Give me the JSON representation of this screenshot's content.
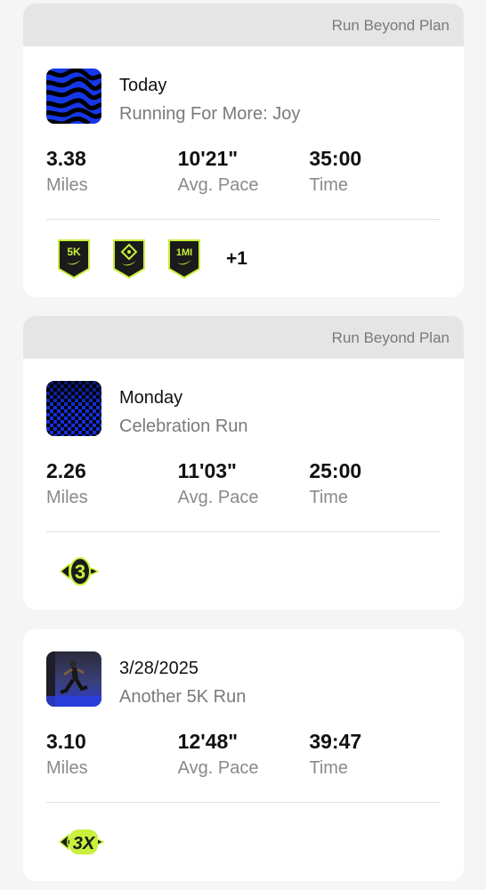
{
  "activities": [
    {
      "header": "Run Beyond Plan",
      "when": "Today",
      "name": "Running For More: Joy",
      "thumbnail": "blue-wavy-pattern",
      "stats": [
        {
          "value": "3.38",
          "label": "Miles"
        },
        {
          "value": "10'21\"",
          "label": "Avg. Pace"
        },
        {
          "value": "35:00",
          "label": "Time"
        }
      ],
      "badges": [
        {
          "icon": "5k-badge-icon",
          "text": "5K"
        },
        {
          "icon": "diamond-badge-icon",
          "text": ""
        },
        {
          "icon": "1mi-badge-icon",
          "text": "1MI"
        }
      ],
      "more_badges": "+1"
    },
    {
      "header": "Run Beyond Plan",
      "when": "Monday",
      "name": "Celebration Run",
      "thumbnail": "blue-checker-pattern",
      "stats": [
        {
          "value": "2.26",
          "label": "Miles"
        },
        {
          "value": "11'03\"",
          "label": "Avg. Pace"
        },
        {
          "value": "25:00",
          "label": "Time"
        }
      ],
      "badges": [
        {
          "icon": "3-streak-arrow-badge-icon",
          "text": "3"
        }
      ]
    },
    {
      "when": "3/28/2025",
      "name": "Another 5K Run",
      "thumbnail": "runner-photo",
      "stats": [
        {
          "value": "3.10",
          "label": "Miles"
        },
        {
          "value": "12'48\"",
          "label": "Avg. Pace"
        },
        {
          "value": "39:47",
          "label": "Time"
        }
      ],
      "badges": [
        {
          "icon": "3x-arrow-badge-icon",
          "text": "3X"
        }
      ]
    }
  ],
  "colors": {
    "badge_fill": "#1b1b1b",
    "badge_accent": "#c8f03c",
    "header_bg": "#e5e5e5",
    "muted_text": "#7a7a7a"
  }
}
